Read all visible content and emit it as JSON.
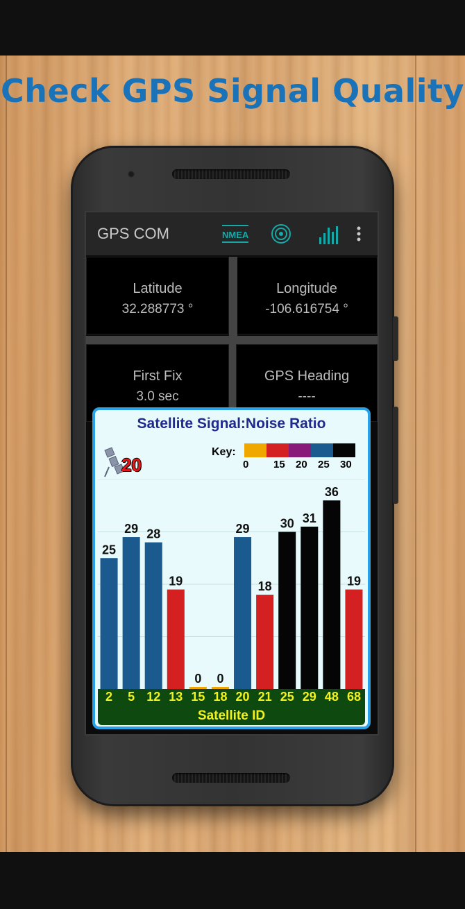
{
  "headline": "Check GPS Signal Quality",
  "app": {
    "title": "GPS COM",
    "nmea_label": "NMEA",
    "icons": [
      "nmea-icon",
      "target-icon",
      "signal-bars-icon",
      "more-vert-icon"
    ]
  },
  "tiles": {
    "latitude_label": "Latitude",
    "latitude_value": "32.288773 °",
    "longitude_label": "Longitude",
    "longitude_value": "-106.616754 °",
    "first_fix_label": "First Fix",
    "first_fix_value": "3.0 sec",
    "heading_label": "GPS Heading",
    "heading_value": "----"
  },
  "dialog": {
    "title": "Satellite Signal:Noise Ratio",
    "sat_count": "20",
    "key_label": "Key:",
    "key_colors": [
      "#f0a800",
      "#d42020",
      "#8a1a7a",
      "#1a5a8e",
      "#050505"
    ],
    "key_ticks": [
      "0",
      "15",
      "20",
      "25",
      "30"
    ]
  },
  "chart_data": {
    "type": "bar",
    "title": "Satellite Signal:Noise Ratio",
    "xlabel": "Satellite ID",
    "ylabel": "",
    "categories": [
      "2",
      "5",
      "12",
      "13",
      "15",
      "18",
      "20",
      "21",
      "25",
      "29",
      "48",
      "68"
    ],
    "values": [
      25,
      29,
      28,
      19,
      0,
      0,
      29,
      18,
      30,
      31,
      36,
      19
    ],
    "ylim": [
      0,
      40
    ],
    "grid": true,
    "color_scale": [
      {
        "min": 0,
        "color": "#f0a800"
      },
      {
        "min": 15,
        "color": "#d42020"
      },
      {
        "min": 20,
        "color": "#8a1a7a"
      },
      {
        "min": 25,
        "color": "#1a5a8e"
      },
      {
        "min": 30,
        "color": "#050505"
      }
    ]
  }
}
